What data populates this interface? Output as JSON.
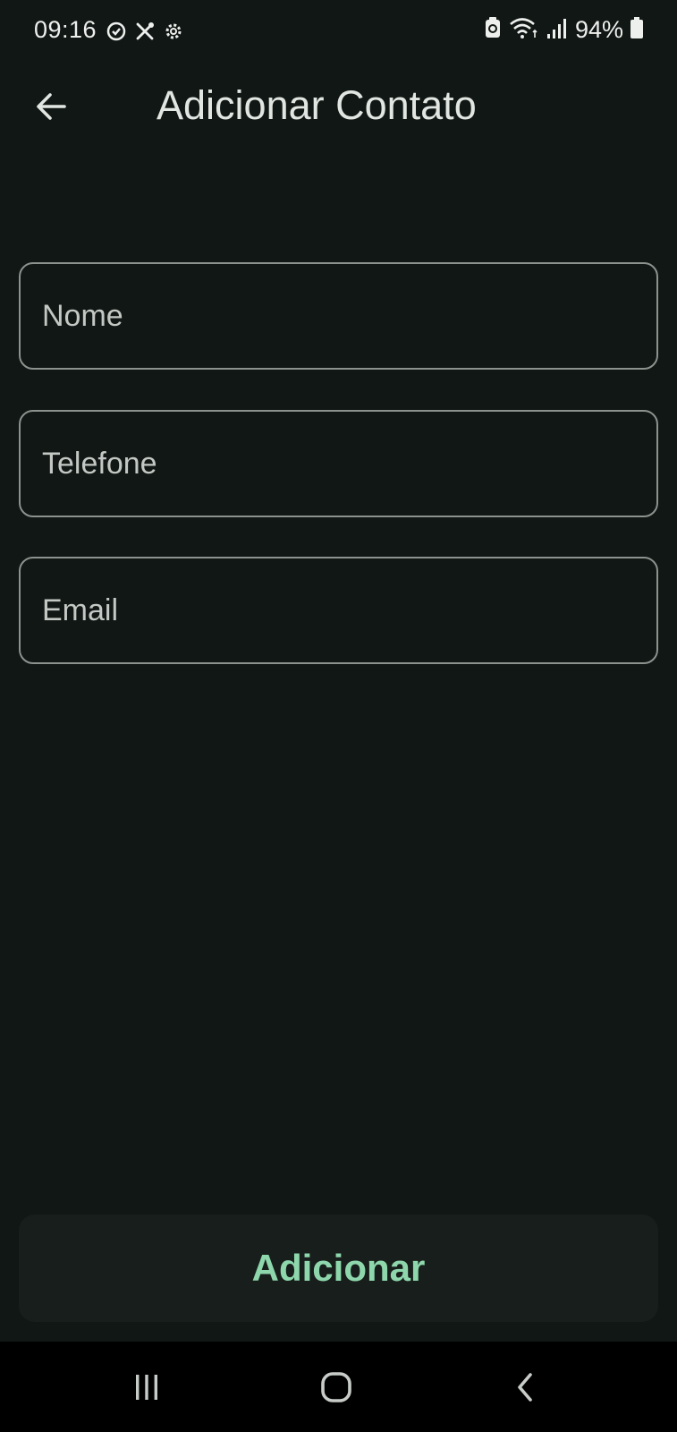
{
  "status_bar": {
    "time": "09:16",
    "battery": "94%",
    "left_icons": [
      "alarm-check-icon",
      "tools-icon",
      "settings-gear-icon"
    ],
    "right_icons": [
      "battery-saver-icon",
      "wifi-icon",
      "signal-icon",
      "battery-icon"
    ]
  },
  "app_bar": {
    "title": "Adicionar Contato",
    "back_icon": "arrow-left-icon"
  },
  "form": {
    "name_placeholder": "Nome",
    "name_value": "",
    "phone_placeholder": "Telefone",
    "phone_value": "",
    "email_placeholder": "Email",
    "email_value": ""
  },
  "actions": {
    "submit_label": "Adicionar"
  },
  "nav_bar": {
    "icons": [
      "recent-apps-icon",
      "home-icon",
      "back-icon"
    ]
  },
  "colors": {
    "background": "#111714",
    "accent": "#8ed7ac",
    "field_border": "#8c928e",
    "button_background": "#181e1b",
    "nav_background": "#000000"
  }
}
